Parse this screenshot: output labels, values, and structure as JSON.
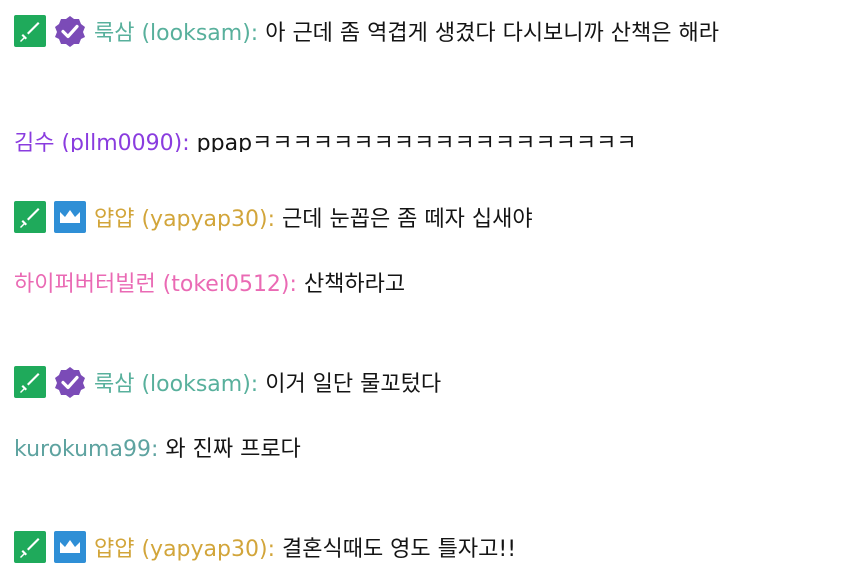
{
  "messages": [
    {
      "name": "룩삼 (looksam)",
      "sep": ":",
      "text": " 아 근데 좀 역겹게 생겼다 다시보니까 산책은 해라",
      "color": "#58b09c",
      "badges": [
        "moderator-sword",
        "verified-check"
      ]
    },
    {
      "name": "김수 (pllm0090)",
      "sep": ":",
      "text": " ppapㅋㅋㅋㅋㅋㅋㅋㅋㅋㅋㅋㅋㅋㅋㅋㅋㅋㅋㅋ",
      "color": "#8a3cdf",
      "badges": []
    },
    {
      "name": "얍얍 (yapyap30)",
      "sep": ":",
      "text": " 근데 눈꼽은 좀 떼자 십새야",
      "color": "#d2a53a",
      "badges": [
        "moderator-sword",
        "crown"
      ]
    },
    {
      "name": "하이퍼버터빌런 (tokei0512)",
      "sep": ":",
      "text": " 산책하라고",
      "color": "#ea6ab4",
      "badges": []
    },
    {
      "name": "룩삼 (looksam)",
      "sep": ":",
      "text": " 이거 일단 물꼬텄다",
      "color": "#58b09c",
      "badges": [
        "moderator-sword",
        "verified-check"
      ]
    },
    {
      "name": "kurokuma99",
      "sep": ":",
      "text": " 와 진짜 프로다",
      "color": "#5ea3a0",
      "badges": []
    },
    {
      "name": "얍얍 (yapyap30)",
      "sep": ":",
      "text": " 결혼식때도 영도 틀자고!!",
      "color": "#d2a53a",
      "badges": [
        "moderator-sword",
        "crown"
      ]
    }
  ],
  "colors": {
    "mod_green": "#1faa5b",
    "verified_purple": "#7b4bb7",
    "crown_blue": "#2f8fd6"
  }
}
